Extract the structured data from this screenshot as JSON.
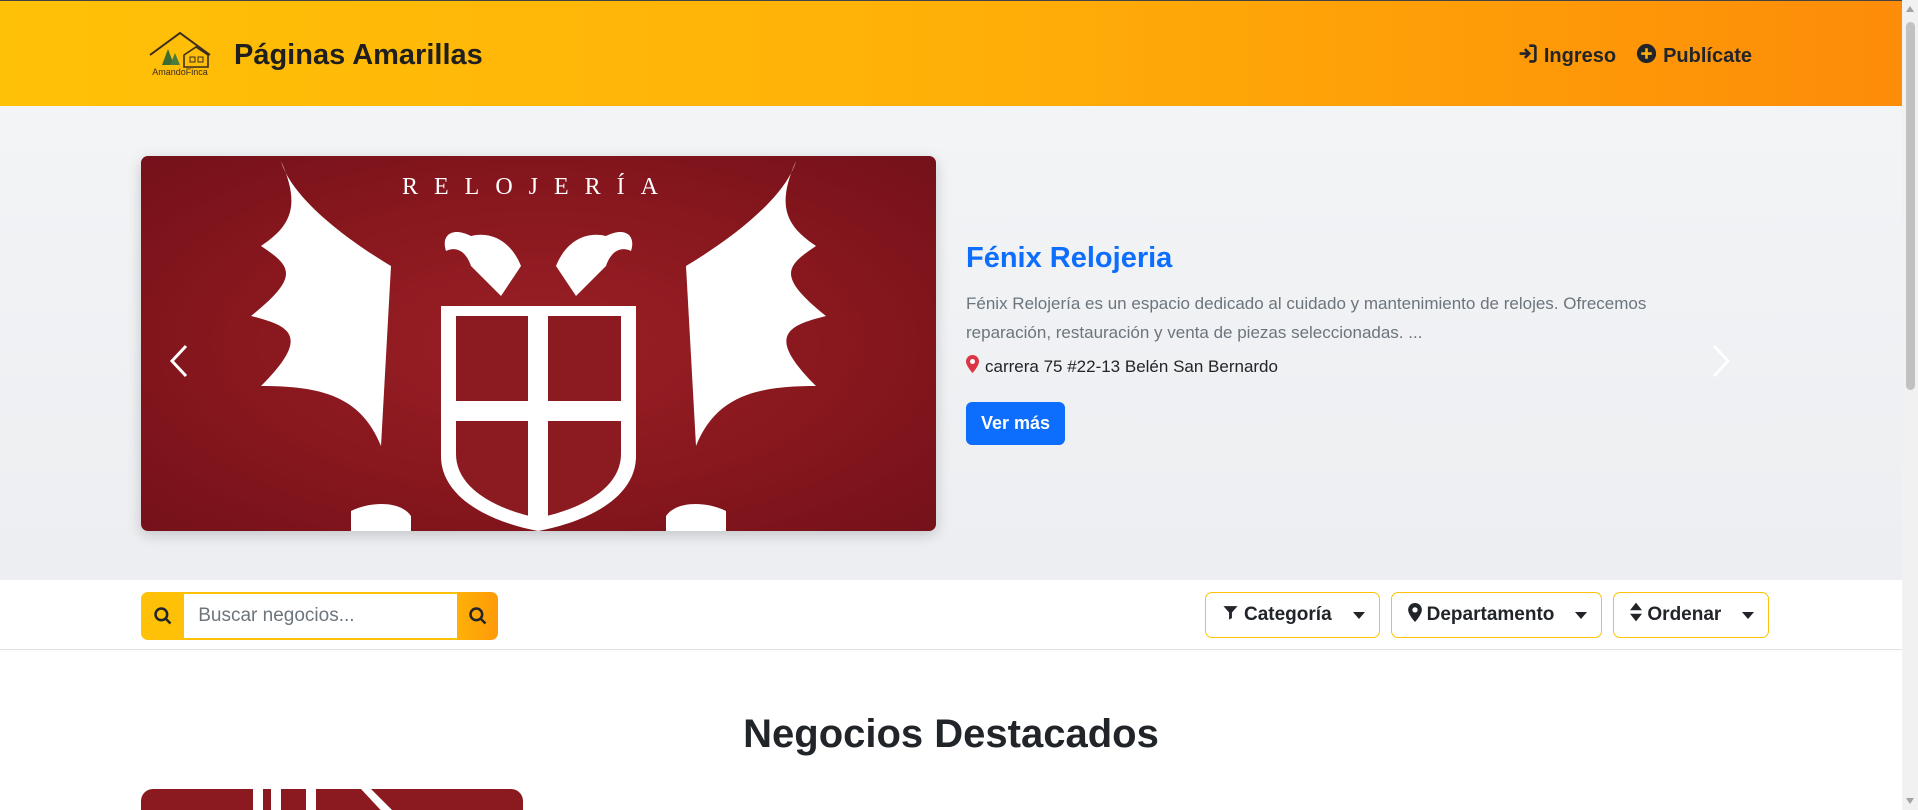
{
  "header": {
    "brand_name": "Páginas Amarillas",
    "logo_text": "AmandoFinca",
    "login_label": "Ingreso",
    "publish_label": "Publícate"
  },
  "hero": {
    "image_text": "RELOJERÍA",
    "title": "Fénix Relojeria",
    "description": "Fénix Relojería es un espacio dedicado al cuidado y mantenimiento de relojes. Ofrecemos reparación, restauración y venta de piezas seleccionadas. ...",
    "address": "carrera 75 #22-13 Belén San Bernardo",
    "button_label": "Ver más"
  },
  "filters": {
    "search_placeholder": "Buscar negocios...",
    "category_label": "Categoría",
    "department_label": "Departamento",
    "sort_label": "Ordenar"
  },
  "featured": {
    "title": "Negocios Destacados"
  },
  "colors": {
    "primary": "#0d6efd",
    "accent": "#ffc107",
    "accent_end": "#fd8c08",
    "hero_image_bg": "#86161d"
  },
  "icons": {
    "login": "sign-in-icon",
    "publish": "plus-circle-icon",
    "location": "map-marker-icon",
    "search": "search-icon",
    "category": "filter-icon",
    "department": "map-marker-icon",
    "sort": "sort-icon"
  }
}
